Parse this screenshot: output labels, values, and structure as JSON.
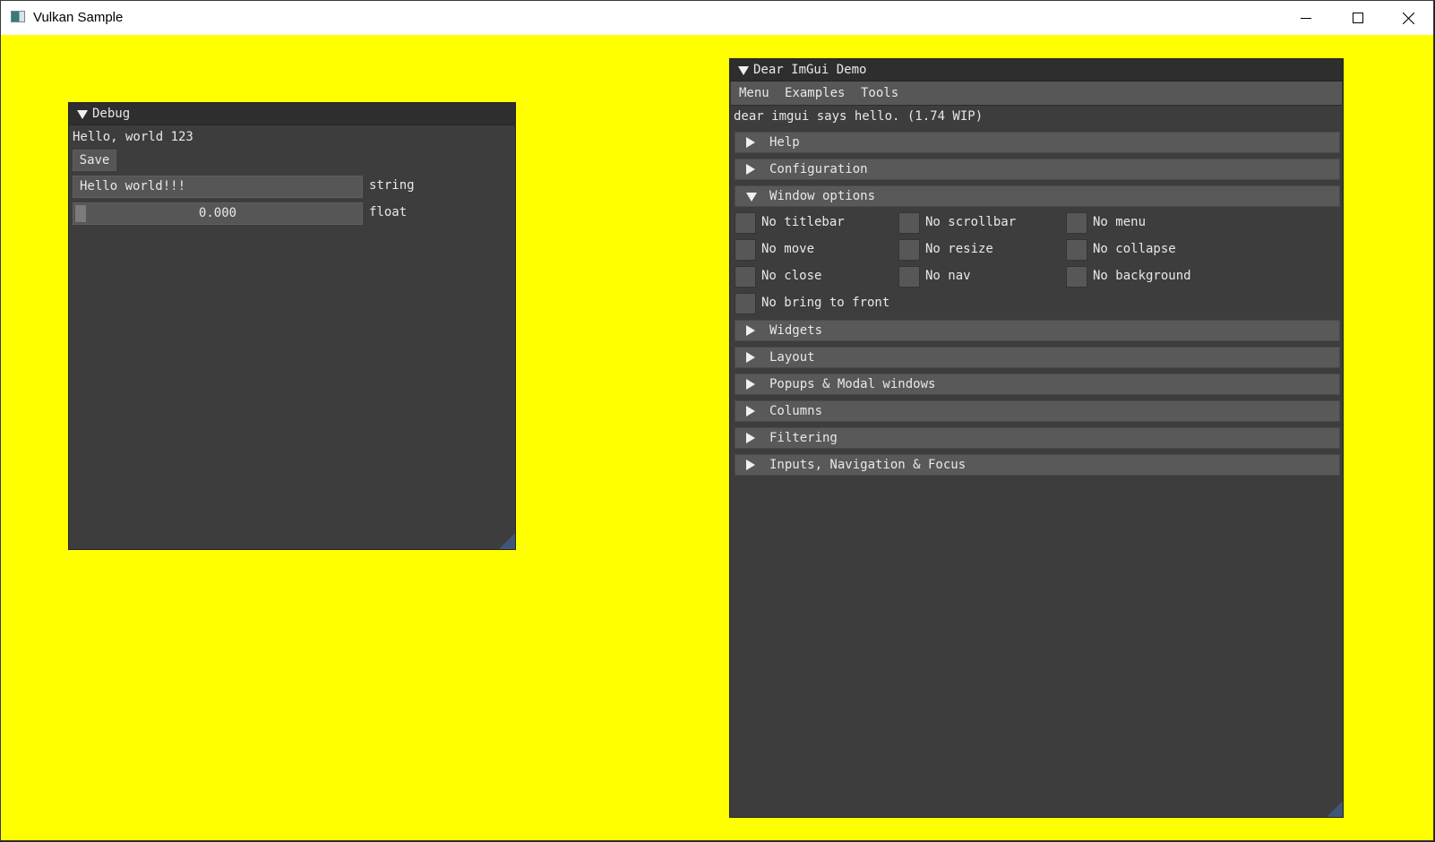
{
  "os_window": {
    "title": "Vulkan Sample",
    "background_color": "#ffff00",
    "controls": [
      "minimize-icon",
      "maximize-icon",
      "close-icon"
    ]
  },
  "debug_window": {
    "title": "Debug",
    "text": "Hello, world 123",
    "save_label": "Save",
    "string_input": {
      "value": "Hello world!!!",
      "label": "string"
    },
    "float_slider": {
      "value": "0.000",
      "label": "float",
      "fraction": 0.0
    }
  },
  "demo_window": {
    "title": "Dear ImGui Demo",
    "menu": [
      "Menu",
      "Examples",
      "Tools"
    ],
    "hello_text": "dear imgui says hello. (1.74 WIP)",
    "sections_before": [
      {
        "label": "Help",
        "expanded": false
      },
      {
        "label": "Configuration",
        "expanded": false
      }
    ],
    "window_options": {
      "label": "Window options",
      "expanded": true,
      "checkboxes": [
        {
          "label": "No titlebar",
          "checked": false
        },
        {
          "label": "No scrollbar",
          "checked": false
        },
        {
          "label": "No menu",
          "checked": false
        },
        {
          "label": "No move",
          "checked": false
        },
        {
          "label": "No resize",
          "checked": false
        },
        {
          "label": "No collapse",
          "checked": false
        },
        {
          "label": "No close",
          "checked": false
        },
        {
          "label": "No nav",
          "checked": false
        },
        {
          "label": "No background",
          "checked": false
        },
        {
          "label": "No bring to front",
          "checked": false
        }
      ]
    },
    "sections_after": [
      {
        "label": "Widgets",
        "expanded": false
      },
      {
        "label": "Layout",
        "expanded": false
      },
      {
        "label": "Popups & Modal windows",
        "expanded": false
      },
      {
        "label": "Columns",
        "expanded": false
      },
      {
        "label": "Filtering",
        "expanded": false
      },
      {
        "label": "Inputs, Navigation & Focus",
        "expanded": false
      }
    ]
  }
}
